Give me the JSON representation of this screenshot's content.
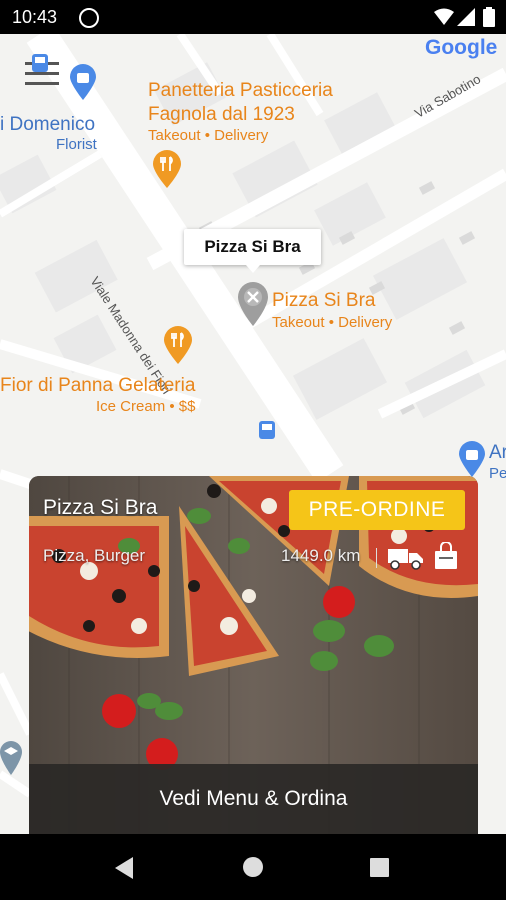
{
  "status": {
    "time": "10:43"
  },
  "map": {
    "google_logo": "Google",
    "places": [
      {
        "name": "Panetteria Pasticceria",
        "name2": "Fagnola dal 1923",
        "sub": "Takeout • Delivery"
      },
      {
        "name": "i Domenico",
        "sub": "Florist"
      },
      {
        "name": "Pizza Si Bra",
        "sub": "Takeout • Delivery"
      },
      {
        "name": "Fior di Panna Gelateria",
        "sub": "Ice Cream • $$"
      },
      {
        "name": "Ar",
        "sub": "Pe"
      }
    ],
    "streets": [
      "Viale Madonna dei Fiori",
      "Via Sabotino"
    ],
    "tooltip": "Pizza Si Bra"
  },
  "card": {
    "title": "Pizza Si Bra",
    "categories": "Pizza, Burger",
    "distance": "1449.0 km",
    "preorder_label": "PRE-ORDINE",
    "cta_label": "Vedi Menu & Ordina"
  }
}
